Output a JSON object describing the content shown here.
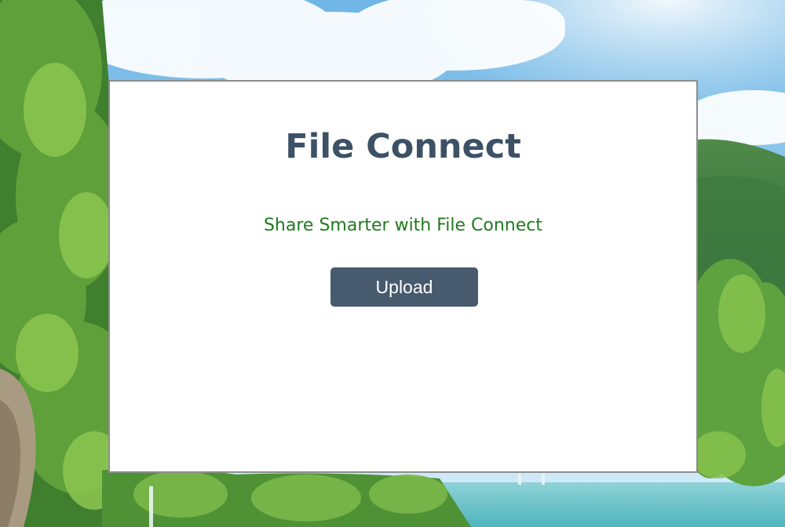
{
  "card": {
    "title": "File Connect",
    "tagline": "Share Smarter with File Connect",
    "upload_label": "Upload"
  },
  "colors": {
    "title": "#3d5166",
    "tagline": "#1f7a1f",
    "button_bg": "#475a6e",
    "button_text": "#ffffff",
    "card_border": "#8d8d8d"
  }
}
